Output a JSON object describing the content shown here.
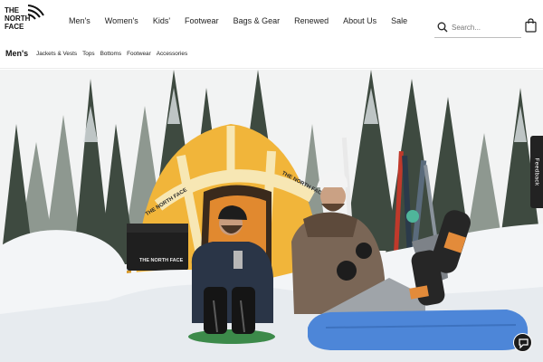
{
  "brand": {
    "logo_line1": "THE",
    "logo_line2": "NORTH",
    "logo_line3": "FACE"
  },
  "nav": {
    "items": [
      "Men's",
      "Women's",
      "Kids'",
      "Footwear",
      "Bags & Gear",
      "Renewed",
      "About Us",
      "Sale"
    ]
  },
  "search": {
    "placeholder": "Search...",
    "icon": "search-icon"
  },
  "cart": {
    "icon": "shopping-bag-icon"
  },
  "subnav": {
    "title": "Men's",
    "items": [
      "Jackets & Vests",
      "Tops",
      "Bottoms",
      "Footwear",
      "Accessories"
    ]
  },
  "hero": {
    "tent_print": "THE NORTH FACE",
    "cooler_print": "THE NORTH FACE",
    "colors": {
      "sky": "#f2f3f3",
      "tent_yellow": "#f1b53a",
      "snow": "#f3f5f7",
      "pad_blue": "#4d86d8"
    }
  },
  "feedback": {
    "label": "Feedback"
  },
  "chat": {
    "icon": "chat-icon"
  }
}
